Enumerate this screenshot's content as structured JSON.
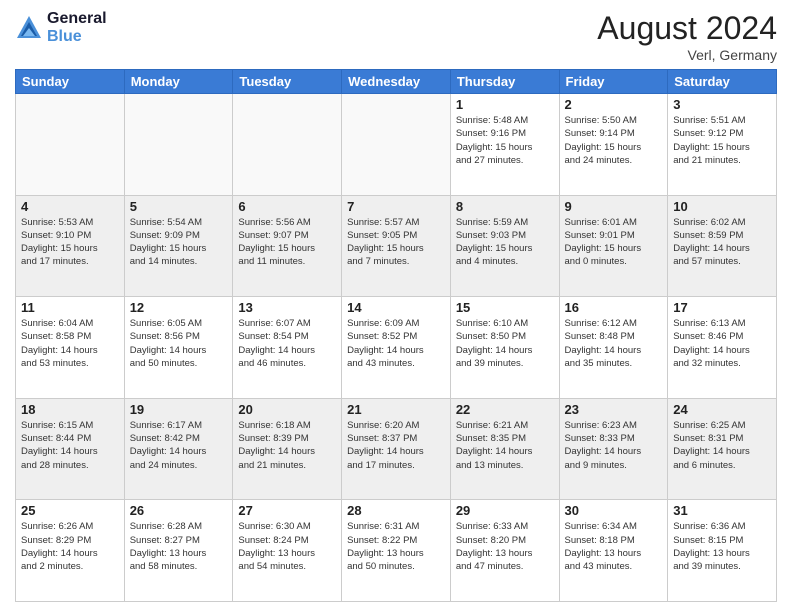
{
  "logo": {
    "line1": "General",
    "line2": "Blue"
  },
  "title": "August 2024",
  "location": "Verl, Germany",
  "days_of_week": [
    "Sunday",
    "Monday",
    "Tuesday",
    "Wednesday",
    "Thursday",
    "Friday",
    "Saturday"
  ],
  "weeks": [
    [
      {
        "day": "",
        "info": ""
      },
      {
        "day": "",
        "info": ""
      },
      {
        "day": "",
        "info": ""
      },
      {
        "day": "",
        "info": ""
      },
      {
        "day": "1",
        "info": "Sunrise: 5:48 AM\nSunset: 9:16 PM\nDaylight: 15 hours\nand 27 minutes."
      },
      {
        "day": "2",
        "info": "Sunrise: 5:50 AM\nSunset: 9:14 PM\nDaylight: 15 hours\nand 24 minutes."
      },
      {
        "day": "3",
        "info": "Sunrise: 5:51 AM\nSunset: 9:12 PM\nDaylight: 15 hours\nand 21 minutes."
      }
    ],
    [
      {
        "day": "4",
        "info": "Sunrise: 5:53 AM\nSunset: 9:10 PM\nDaylight: 15 hours\nand 17 minutes."
      },
      {
        "day": "5",
        "info": "Sunrise: 5:54 AM\nSunset: 9:09 PM\nDaylight: 15 hours\nand 14 minutes."
      },
      {
        "day": "6",
        "info": "Sunrise: 5:56 AM\nSunset: 9:07 PM\nDaylight: 15 hours\nand 11 minutes."
      },
      {
        "day": "7",
        "info": "Sunrise: 5:57 AM\nSunset: 9:05 PM\nDaylight: 15 hours\nand 7 minutes."
      },
      {
        "day": "8",
        "info": "Sunrise: 5:59 AM\nSunset: 9:03 PM\nDaylight: 15 hours\nand 4 minutes."
      },
      {
        "day": "9",
        "info": "Sunrise: 6:01 AM\nSunset: 9:01 PM\nDaylight: 15 hours\nand 0 minutes."
      },
      {
        "day": "10",
        "info": "Sunrise: 6:02 AM\nSunset: 8:59 PM\nDaylight: 14 hours\nand 57 minutes."
      }
    ],
    [
      {
        "day": "11",
        "info": "Sunrise: 6:04 AM\nSunset: 8:58 PM\nDaylight: 14 hours\nand 53 minutes."
      },
      {
        "day": "12",
        "info": "Sunrise: 6:05 AM\nSunset: 8:56 PM\nDaylight: 14 hours\nand 50 minutes."
      },
      {
        "day": "13",
        "info": "Sunrise: 6:07 AM\nSunset: 8:54 PM\nDaylight: 14 hours\nand 46 minutes."
      },
      {
        "day": "14",
        "info": "Sunrise: 6:09 AM\nSunset: 8:52 PM\nDaylight: 14 hours\nand 43 minutes."
      },
      {
        "day": "15",
        "info": "Sunrise: 6:10 AM\nSunset: 8:50 PM\nDaylight: 14 hours\nand 39 minutes."
      },
      {
        "day": "16",
        "info": "Sunrise: 6:12 AM\nSunset: 8:48 PM\nDaylight: 14 hours\nand 35 minutes."
      },
      {
        "day": "17",
        "info": "Sunrise: 6:13 AM\nSunset: 8:46 PM\nDaylight: 14 hours\nand 32 minutes."
      }
    ],
    [
      {
        "day": "18",
        "info": "Sunrise: 6:15 AM\nSunset: 8:44 PM\nDaylight: 14 hours\nand 28 minutes."
      },
      {
        "day": "19",
        "info": "Sunrise: 6:17 AM\nSunset: 8:42 PM\nDaylight: 14 hours\nand 24 minutes."
      },
      {
        "day": "20",
        "info": "Sunrise: 6:18 AM\nSunset: 8:39 PM\nDaylight: 14 hours\nand 21 minutes."
      },
      {
        "day": "21",
        "info": "Sunrise: 6:20 AM\nSunset: 8:37 PM\nDaylight: 14 hours\nand 17 minutes."
      },
      {
        "day": "22",
        "info": "Sunrise: 6:21 AM\nSunset: 8:35 PM\nDaylight: 14 hours\nand 13 minutes."
      },
      {
        "day": "23",
        "info": "Sunrise: 6:23 AM\nSunset: 8:33 PM\nDaylight: 14 hours\nand 9 minutes."
      },
      {
        "day": "24",
        "info": "Sunrise: 6:25 AM\nSunset: 8:31 PM\nDaylight: 14 hours\nand 6 minutes."
      }
    ],
    [
      {
        "day": "25",
        "info": "Sunrise: 6:26 AM\nSunset: 8:29 PM\nDaylight: 14 hours\nand 2 minutes."
      },
      {
        "day": "26",
        "info": "Sunrise: 6:28 AM\nSunset: 8:27 PM\nDaylight: 13 hours\nand 58 minutes."
      },
      {
        "day": "27",
        "info": "Sunrise: 6:30 AM\nSunset: 8:24 PM\nDaylight: 13 hours\nand 54 minutes."
      },
      {
        "day": "28",
        "info": "Sunrise: 6:31 AM\nSunset: 8:22 PM\nDaylight: 13 hours\nand 50 minutes."
      },
      {
        "day": "29",
        "info": "Sunrise: 6:33 AM\nSunset: 8:20 PM\nDaylight: 13 hours\nand 47 minutes."
      },
      {
        "day": "30",
        "info": "Sunrise: 6:34 AM\nSunset: 8:18 PM\nDaylight: 13 hours\nand 43 minutes."
      },
      {
        "day": "31",
        "info": "Sunrise: 6:36 AM\nSunset: 8:15 PM\nDaylight: 13 hours\nand 39 minutes."
      }
    ]
  ]
}
